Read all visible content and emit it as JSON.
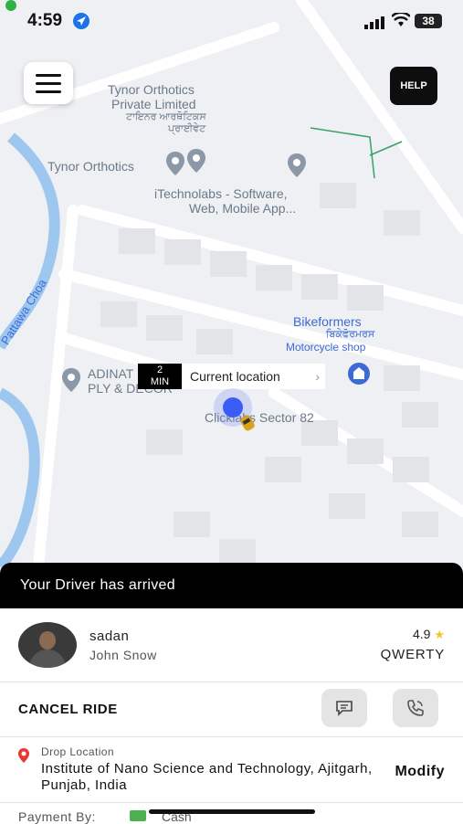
{
  "status_bar": {
    "time": "4:59",
    "battery": "38"
  },
  "map": {
    "labels": {
      "tynor_private_1": "Tynor Orthotics",
      "tynor_private_2": "Private Limited",
      "tynor_private_punjabi_1": "ਟਾਇਨਰ ਆਰਥੋਟਿਕਸ",
      "tynor_private_punjabi_2": "ਪ੍ਰਾਈਵੇਟ",
      "tynor": "Tynor Orthotics",
      "itechnolabs_1": "iTechnolabs - Software,",
      "itechnolabs_2": "Web, Mobile App...",
      "bikeformers": "Bikeformers",
      "bikeformers_punjabi": "ਬਿਕੇਫੋਰਮਰਸ",
      "bikeformers_type": "Motorcycle shop",
      "adinat_1": "ADINAT",
      "adinat_2": "PLY & DECOR",
      "clicklabs": "Clicklabs Sector 82",
      "river": "Pattawa Choa"
    },
    "help_label": "HELP",
    "eta_num": "2",
    "eta_unit": "MIN",
    "current_location": "Current location"
  },
  "banner": {
    "text": "Your Driver has arrived"
  },
  "driver": {
    "name": "sadan",
    "subtitle": "John Snow",
    "rating": "4.9",
    "plate": "QWERTY"
  },
  "actions": {
    "cancel": "CANCEL RIDE"
  },
  "drop": {
    "label": "Drop Location",
    "address": "Institute of Nano Science and Technology, Ajitgarh, Punjab, India",
    "modify": "Modify"
  },
  "payment": {
    "label": "Payment By:",
    "method": "Cash"
  },
  "colors": {
    "accent_dark": "#000000",
    "pin_red": "#e53935",
    "user_dot": "#3b5cf5",
    "star": "#f3c623",
    "cash_green": "#4caf50"
  }
}
